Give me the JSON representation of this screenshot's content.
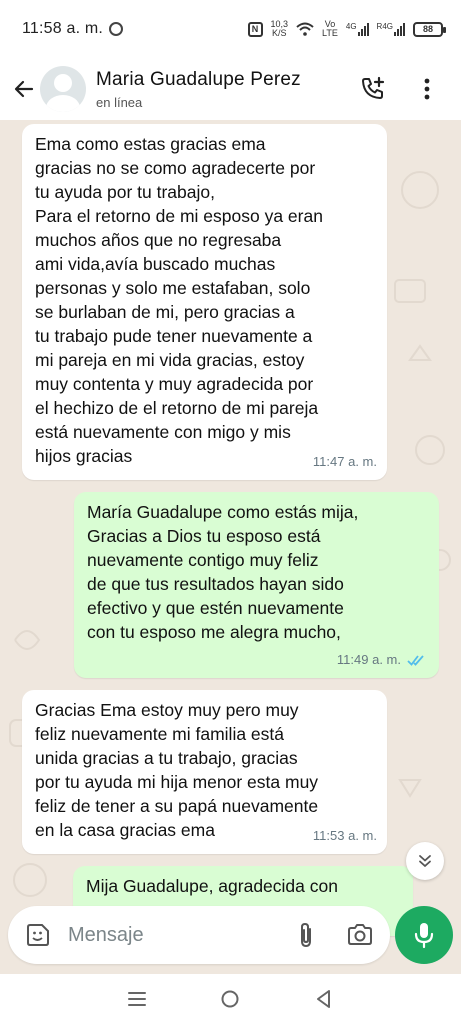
{
  "status_bar": {
    "time": "11:58 a. m.",
    "speed_value": "10,3",
    "speed_unit": "K/S",
    "volte": "Vo",
    "volte2": "LTE",
    "net1": "4G",
    "net2": "R4G",
    "battery": "88"
  },
  "header": {
    "contact_name": "Maria Guadalupe Perez",
    "presence": "en línea"
  },
  "messages": [
    {
      "direction": "in",
      "text": "Ema como estas gracias ema\ngracias no se como agradecerte por\ntu ayuda por tu trabajo,\nPara el retorno de mi esposo ya eran\nmuchos años que no regresaba\nami vida,avía buscado muchas\npersonas y solo me estafaban, solo\nse burlaban de mi, pero gracias a\ntu trabajo pude tener nuevamente a\nmi pareja en mi vida gracias, estoy\nmuy contenta y muy agradecida por\nel hechizo de el retorno de mi pareja\nestá nuevamente con migo y mis\nhijos gracias",
      "time": "11:47 a. m."
    },
    {
      "direction": "out",
      "text": "María Guadalupe como estás mija,\nGracias a Dios tu esposo está\nnuevamente contigo muy feliz\nde que tus resultados hayan sido\nefectivo y que estén nuevamente\ncon tu esposo me alegra mucho,",
      "time": "11:49 a. m.",
      "status": "read"
    },
    {
      "direction": "in",
      "text": "Gracias Ema estoy muy pero muy\nfeliz nuevamente mi familia está\nunida gracias a tu trabajo, gracias\npor tu ayuda mi hija menor esta muy\nfeliz de tener a su papá nuevamente\nen la casa gracias ema",
      "time": "11:53 a. m."
    },
    {
      "direction": "out",
      "text": "Mija Guadalupe, agradecida con",
      "time": ""
    }
  ],
  "input": {
    "placeholder": "Mensaje"
  },
  "colors": {
    "accent": "#1daa61",
    "outgoing_bubble": "#d9fdd3",
    "incoming_bubble": "#ffffff",
    "read_ticks": "#53bdeb",
    "chat_background": "#efe7de"
  }
}
